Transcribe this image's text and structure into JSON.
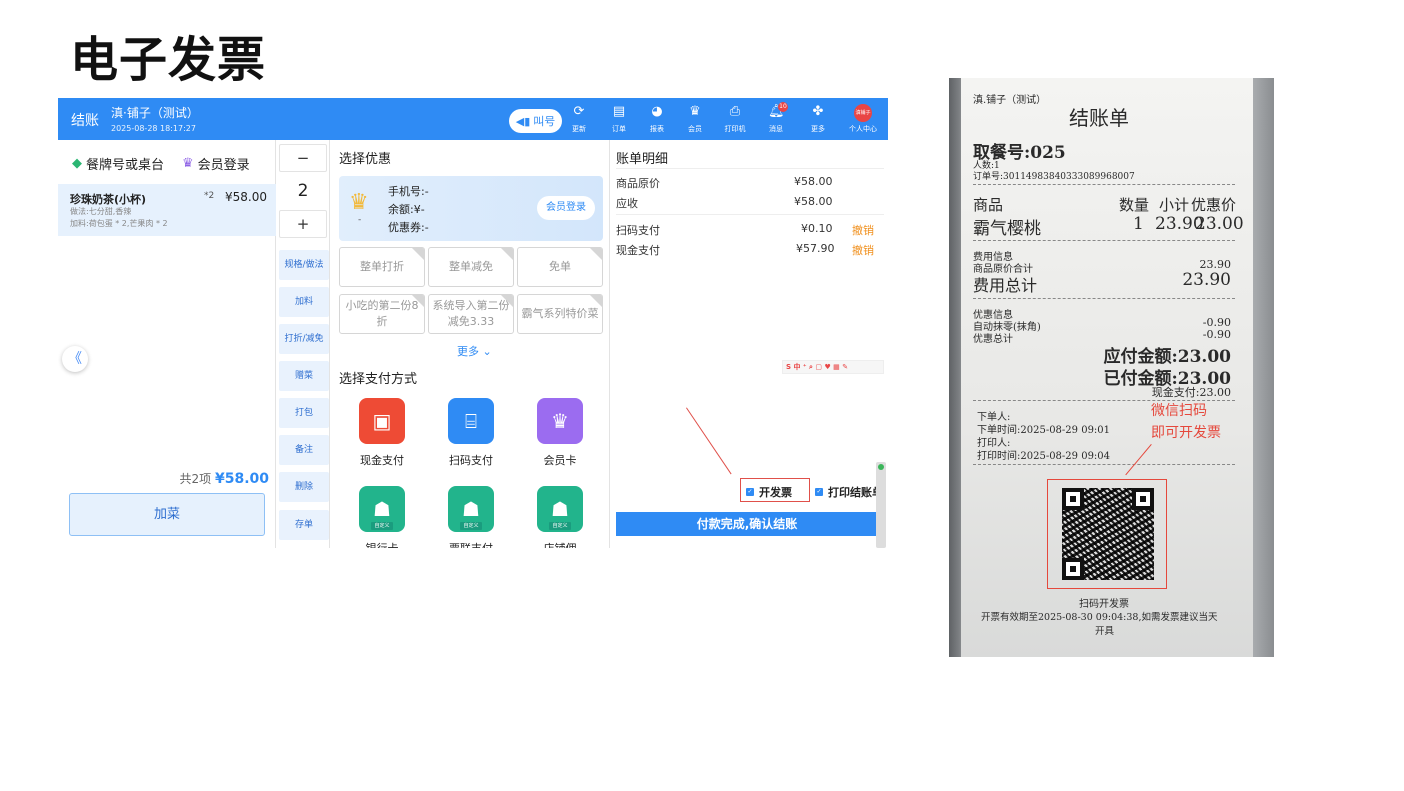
{
  "slide": {
    "title": "电子发票"
  },
  "pos": {
    "header": {
      "checkout": "结账",
      "shop_name": "滇·铺子（测试）",
      "datetime": "2025-08-28 18:17:27",
      "call_button": "叫号",
      "icons": [
        {
          "name": "refresh-icon",
          "label": "更新"
        },
        {
          "name": "order-icon",
          "label": "订单"
        },
        {
          "name": "report-icon",
          "label": "报表"
        },
        {
          "name": "member-icon",
          "label": "会员"
        },
        {
          "name": "printer-icon",
          "label": "打印机"
        },
        {
          "name": "bell-icon",
          "label": "消息",
          "badge": "10"
        },
        {
          "name": "more-icon",
          "label": "更多"
        },
        {
          "name": "avatar-icon",
          "label": "个人中心",
          "avatar_text": "滇铺子"
        }
      ]
    },
    "left": {
      "table_label": "餐牌号或桌台",
      "member_login": "会员登录",
      "item": {
        "name": "珍珠奶茶(小杯)",
        "qty": "*2",
        "price": "¥58.00",
        "method": "做法:七分甜,香辣",
        "addons": "加料:荷包蛋 * 2,芒果肉 * 2"
      },
      "total_prefix": "共2项",
      "total_amount": "¥58.00",
      "add_dish": "加菜"
    },
    "middle": {
      "minus": "−",
      "qty": "2",
      "plus": "+",
      "buttons": [
        "规格/做法",
        "加料",
        "打折/减免",
        "赠菜",
        "打包",
        "备注",
        "删除",
        "存单"
      ]
    },
    "promo": {
      "title": "选择优惠",
      "member_card": {
        "phone": "手机号:-",
        "balance": "余额:¥-",
        "coupon": "优惠券:-",
        "dash": "-",
        "login": "会员登录"
      },
      "options": [
        "整单打折",
        "整单减免",
        "免单",
        "小吃的第二份8折",
        "系统导入第二份减免3.33",
        "霸气系列特价菜"
      ],
      "more": "更多",
      "pay_title": "选择支付方式",
      "pay_methods": [
        {
          "label": "现金支付",
          "color": "#ee4b35"
        },
        {
          "label": "扫码支付",
          "color": "#2f8bf4"
        },
        {
          "label": "会员卡",
          "color": "#9b6cf0"
        },
        {
          "label": "银行卡",
          "color": "#22b48c",
          "tag": "自定义"
        },
        {
          "label": "票联支付",
          "color": "#22b48c",
          "tag": "自定义"
        },
        {
          "label": "店铺佣",
          "color": "#22b48c",
          "tag": "自定义"
        }
      ]
    },
    "bill": {
      "title": "账单明细",
      "original_label": "商品原价",
      "original_value": "¥58.00",
      "receivable_label": "应收",
      "receivable_value": "¥58.00",
      "payments": [
        {
          "label": "扫码支付",
          "value": "¥0.10",
          "cancel": "撤销"
        },
        {
          "label": "现金支付",
          "value": "¥57.90",
          "cancel": "撤销"
        }
      ],
      "ime_bar": "S 中 ⁺ ⌕ ▢ ♥ ▦ ✎",
      "invoice_checkbox": "开发票",
      "print_checkbox": "打印结账单",
      "confirm": "付款完成,确认结账"
    }
  },
  "receipt": {
    "shop": "滇.铺子（测试）",
    "title": "结账单",
    "pickup": "取餐号:025",
    "people": "人数:1",
    "order_no": "订单号:30114983840333089968007",
    "col_item": "商品",
    "col_qty": "数量",
    "col_subtotal": "小计",
    "col_discount": "优惠价",
    "row_item": "霸气樱桃",
    "row_qty": "1",
    "row_subtotal": "23.90",
    "row_discount": "23.00",
    "fee_info": "费用信息",
    "orig_total_label": "商品原价合计",
    "orig_total_value": "23.90",
    "fee_total_label": "费用总计",
    "fee_total_value": "23.90",
    "discount_info": "优惠信息",
    "auto_round_label": "自动抹零(抹角)",
    "auto_round_value": "-0.90",
    "discount_total_label": "优惠总计",
    "discount_total_value": "-0.90",
    "payable": "应付金额:23.00",
    "paid": "已付金额:23.00",
    "cash": "现金支付:23.00",
    "order_person": "下单人:",
    "order_time": "下单时间:2025-08-29 09:01",
    "printer": "打印人:",
    "print_time": "打印时间:2025-08-29 09:04",
    "red_note_1": "微信扫码",
    "red_note_2": "即可开发票",
    "scan_label": "扫码开发票",
    "valid_note_1": "开票有效期至2025-08-30 09:04:38,如需发票建议当天",
    "valid_note_2": "开具"
  }
}
